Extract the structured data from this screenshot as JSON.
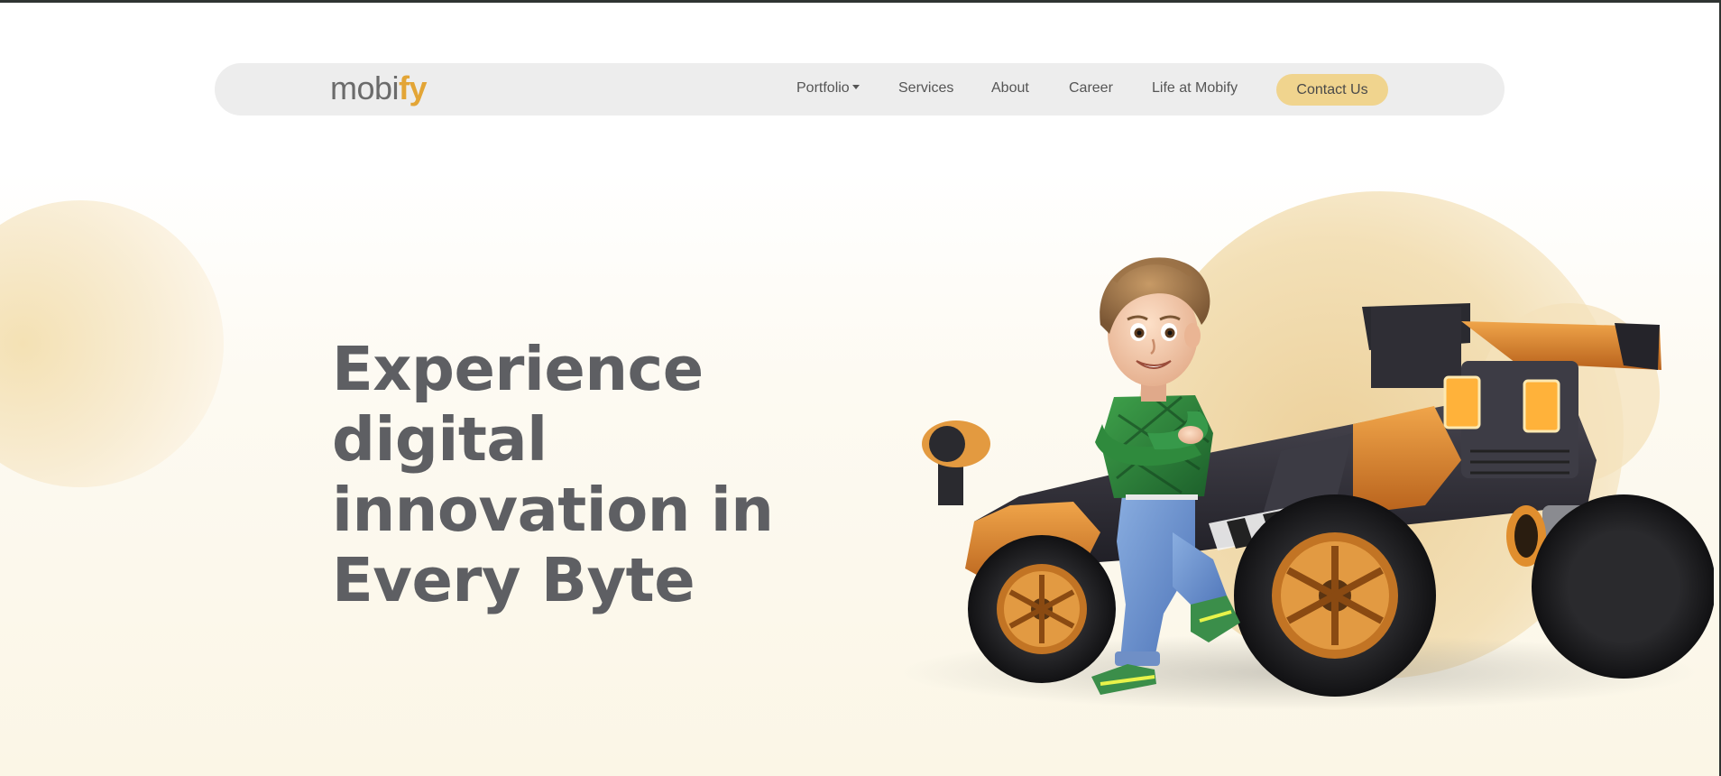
{
  "brand": {
    "logo_part1": "mobi",
    "logo_part2": "fy",
    "logo_color_primary": "#6b6b6b",
    "logo_color_accent": "#e3a536"
  },
  "nav": {
    "items": [
      {
        "label": "Portfolio",
        "has_dropdown": true
      },
      {
        "label": "Services",
        "has_dropdown": false
      },
      {
        "label": "About",
        "has_dropdown": false
      },
      {
        "label": "Career",
        "has_dropdown": false
      },
      {
        "label": "Life at Mobify",
        "has_dropdown": false
      }
    ],
    "contact_label": "Contact Us",
    "contact_color": "#f0d48e"
  },
  "hero": {
    "title_lines": [
      "Experience",
      "digital",
      "innovation in",
      "Every Byte"
    ],
    "title_color": "#5e5f63"
  },
  "illustration": {
    "subject": "cartoon-boy-with-buggy"
  },
  "colors": {
    "accent": "#e3a536",
    "navbar_bg": "#ededed",
    "hero_blob": "#f3e0b7"
  }
}
